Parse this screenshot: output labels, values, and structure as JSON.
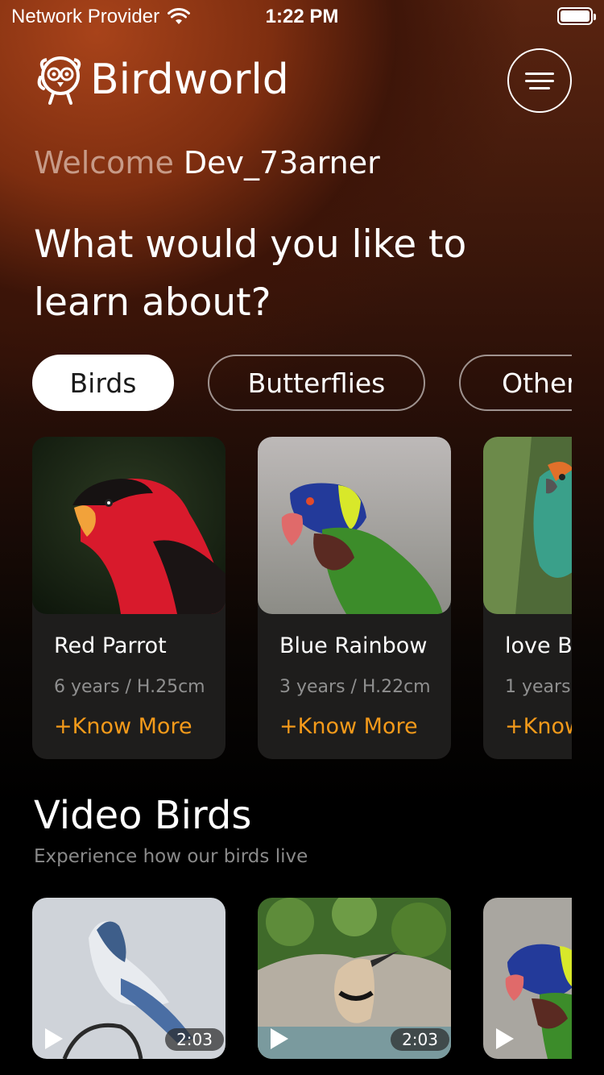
{
  "status_bar": {
    "carrier": "Network Provider",
    "time": "1:22 PM",
    "battery_level": 1.0
  },
  "header": {
    "app_title": "Birdworld",
    "logo_icon": "owl-logo-icon",
    "menu_icon": "hamburger-menu-icon"
  },
  "welcome": {
    "greeting": "Welcome",
    "username": "Dev_73arner"
  },
  "headline": "What would you like to learn about?",
  "categories": [
    {
      "label": "Birds",
      "selected": true
    },
    {
      "label": "Butterflies",
      "selected": false
    },
    {
      "label": "Other",
      "selected": false
    }
  ],
  "cards": [
    {
      "name": "Red Parrot",
      "meta": "6 years / H.25cm",
      "link": "+Know More"
    },
    {
      "name": "Blue Rainbow",
      "meta": "3 years / H.22cm",
      "link": "+Know More"
    },
    {
      "name": "love B",
      "meta": "1 years",
      "link": "+Know"
    }
  ],
  "videos_section": {
    "title": "Video Birds",
    "subtitle": "Experience how our birds live"
  },
  "videos": [
    {
      "duration": "2:03"
    },
    {
      "duration": "2:03"
    },
    {
      "duration": ""
    }
  ],
  "colors": {
    "accent": "#f49a1a",
    "card_bg": "#1e1d1c",
    "gradient_top": "#a8431a"
  }
}
